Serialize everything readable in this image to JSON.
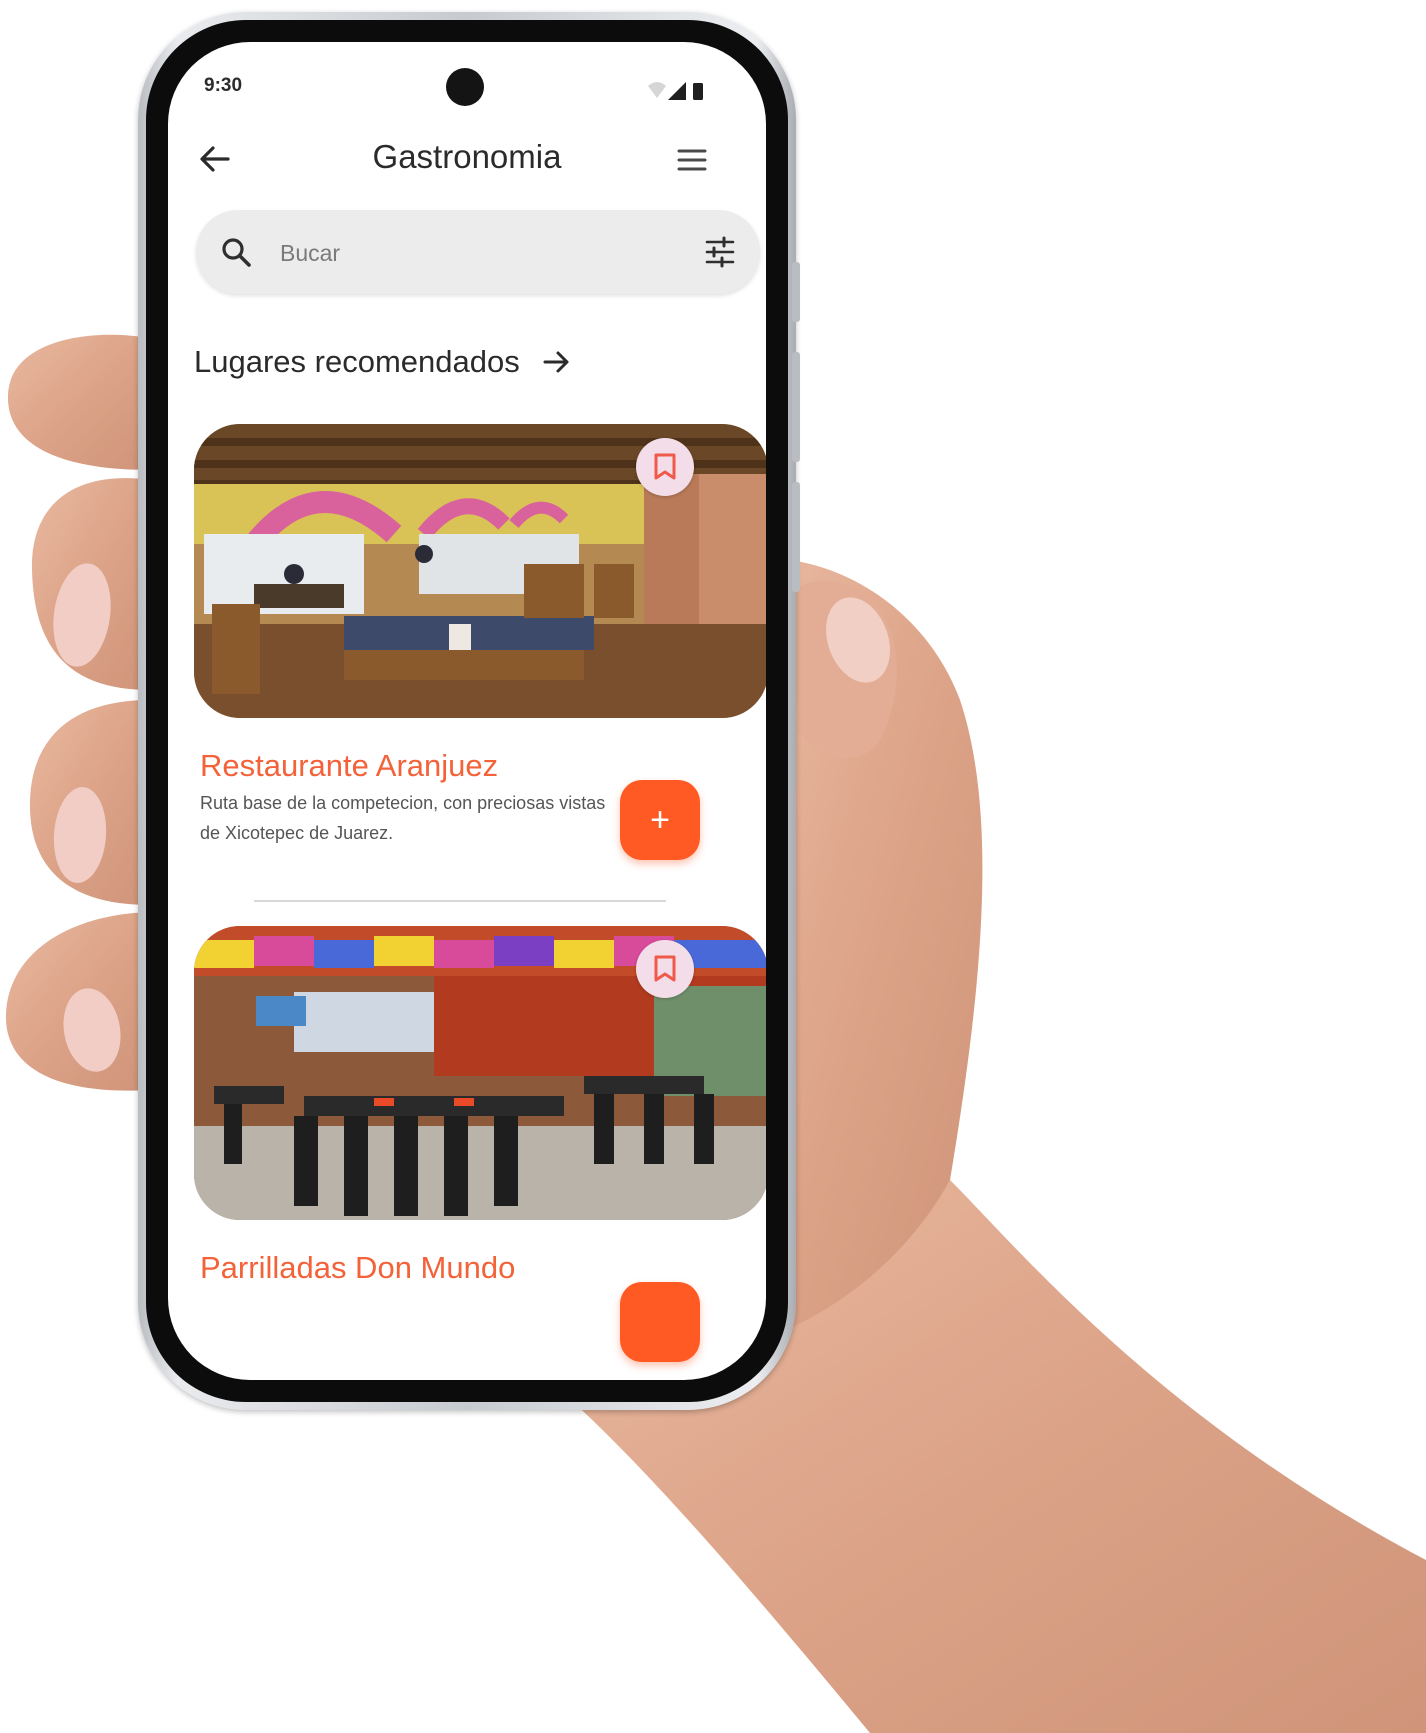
{
  "status_bar": {
    "time": "9:30"
  },
  "app_bar": {
    "title": "Gastronomia",
    "back_icon": "arrow-left-icon",
    "menu_icon": "hamburger-menu-icon"
  },
  "search": {
    "placeholder": "Bucar",
    "value": "",
    "search_icon": "search-icon",
    "filter_icon": "sliders-icon"
  },
  "section": {
    "title": "Lugares recomendados",
    "arrow_icon": "arrow-right-icon"
  },
  "places": [
    {
      "name": "Restaurante Aranjuez",
      "description": "Ruta base de la competecion, con preciosas vistas de Xicotepec de Juarez.",
      "add_label": "+",
      "bookmark_icon": "bookmark-icon"
    },
    {
      "name": "Parrilladas Don Mundo",
      "bookmark_icon": "bookmark-icon"
    }
  ],
  "colors": {
    "accent": "#ff5a24",
    "title_orange": "#f4623a",
    "bookmark_bg": "#f3dde9",
    "bookmark_stroke": "#f05a4a",
    "search_bg": "#ececec"
  }
}
